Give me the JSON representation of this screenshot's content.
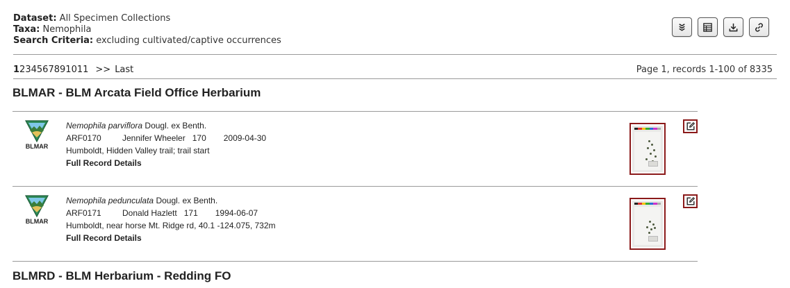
{
  "search_meta": {
    "dataset_label": "Dataset:",
    "dataset_value": "All Specimen Collections",
    "taxa_label": "Taxa:",
    "taxa_value": "Nemophila",
    "criteria_label": "Search Criteria:",
    "criteria_value": "excluding cultivated/captive occurrences"
  },
  "toolbar": {
    "buttons": [
      {
        "icon": "layers-icon"
      },
      {
        "icon": "table-icon"
      },
      {
        "icon": "download-icon"
      },
      {
        "icon": "link-icon"
      }
    ]
  },
  "pager": {
    "current": "1",
    "pages": [
      "2",
      "3",
      "4",
      "5",
      "6",
      "7",
      "8",
      "9",
      "10",
      "11"
    ],
    "next": ">>",
    "last": "Last",
    "info": "Page 1, records 1-100 of 8335"
  },
  "collections": [
    {
      "title": "BLMAR - BLM Arcata Field Office Herbarium",
      "records": [
        {
          "logo_code": "BLMAR",
          "sciname": "Nemophila parviflora",
          "author": "Dougl. ex Benth.",
          "catalog": "ARF0170",
          "collector": "Jennifer Wheeler",
          "number": "170",
          "date": "2009-04-30",
          "locality": "Humboldt, Hidden Valley trail; trail start",
          "details_link": "Full Record Details"
        },
        {
          "logo_code": "BLMAR",
          "sciname": "Nemophila pedunculata",
          "author": "Dougl. ex Benth.",
          "catalog": "ARF0171",
          "collector": "Donald Hazlett",
          "number": "171",
          "date": "1994-06-07",
          "locality": "Humboldt, near horse Mt. Ridge rd, 40.1 -124.075, 732m",
          "details_link": "Full Record Details"
        }
      ]
    },
    {
      "title": "BLMRD - BLM Herbarium - Redding FO",
      "records": []
    }
  ],
  "colors": {
    "accent_red": "#8b1a1a",
    "rule": "#999999",
    "logo_green": "#2e8b57"
  }
}
